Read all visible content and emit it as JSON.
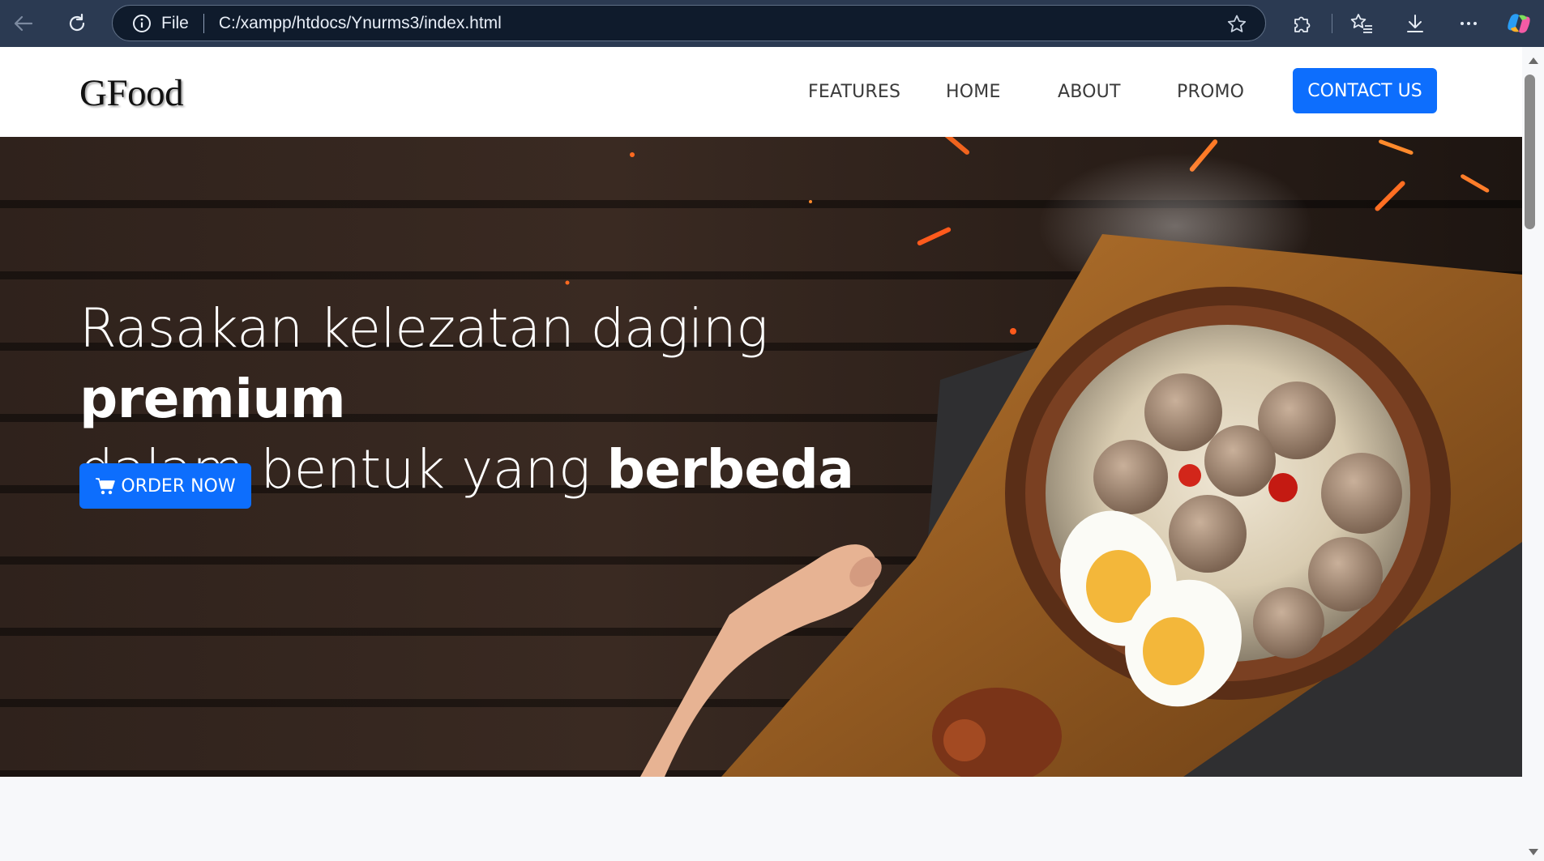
{
  "browser": {
    "back_icon": "arrow-left-icon",
    "reload_icon": "reload-icon",
    "scheme_label": "File",
    "url": "C:/xampp/htdocs/Ynurms3/index.html",
    "favorite_icon": "star-icon",
    "extensions_icon": "puzzle-icon",
    "favorites_icon": "favorites-list-icon",
    "downloads_icon": "download-icon",
    "menu_icon": "more-icon",
    "copilot_icon": "copilot-icon"
  },
  "navbar": {
    "brand": "GFood",
    "links": [
      "FEATURES",
      "HOME",
      "ABOUT",
      "PROMO"
    ],
    "contact_label": "CONTACT US",
    "accent_color": "#0d6efd"
  },
  "hero": {
    "line1_light": "Rasakan kelezatan daging ",
    "line1_bold": "premium",
    "line2_light": "dalam bentuk yang ",
    "line2_bold": "berbeda",
    "order_label": "ORDER NOW",
    "order_icon": "cart-icon"
  }
}
